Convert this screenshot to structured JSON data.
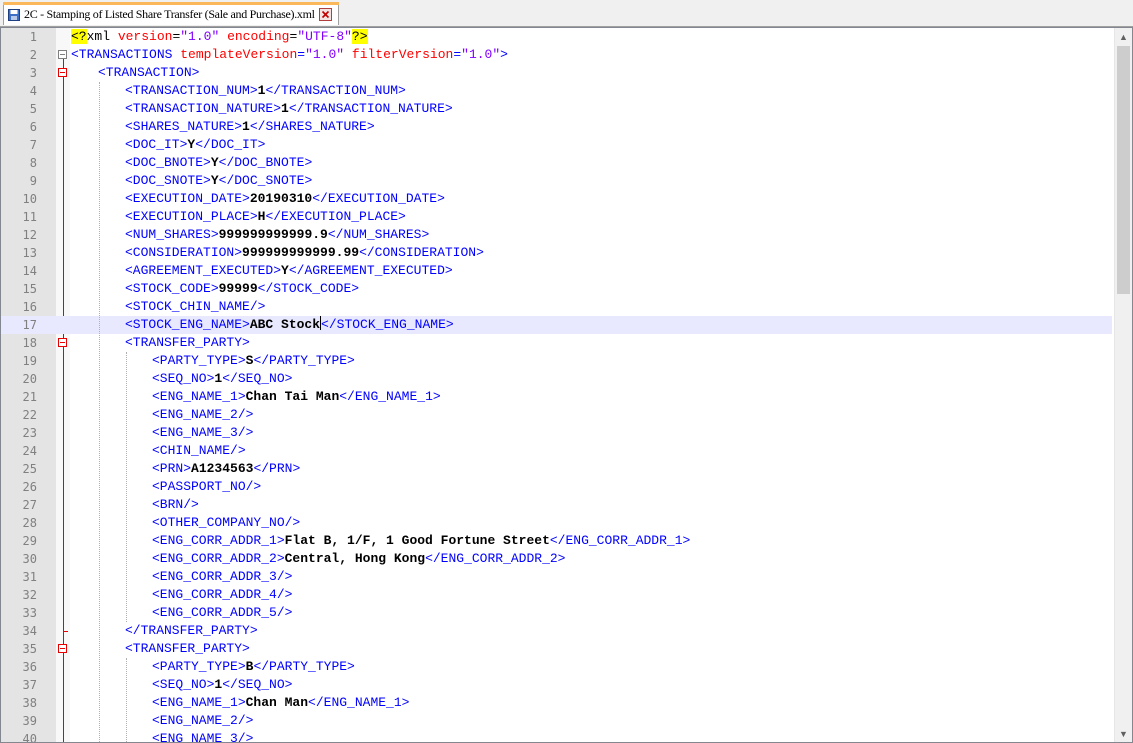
{
  "tab": {
    "title": "2C - Stamping of Listed Share Transfer (Sale and Purchase).xml",
    "save_icon": "floppy-disk-icon",
    "close_icon": "close-icon"
  },
  "colors": {
    "tag": "#0000ff",
    "attribute": "#ff0000",
    "attribute_value": "#8000ff",
    "text": "#000000",
    "highlight": "#ffff00",
    "current_line": "#e8e8ff",
    "fold_marker": "#e60000"
  },
  "editor": {
    "current_line": 17,
    "lines": [
      {
        "n": "1"
      },
      {
        "n": "2"
      },
      {
        "n": "3"
      },
      {
        "n": "4"
      },
      {
        "n": "5"
      },
      {
        "n": "6"
      },
      {
        "n": "7"
      },
      {
        "n": "8"
      },
      {
        "n": "9"
      },
      {
        "n": "10"
      },
      {
        "n": "11"
      },
      {
        "n": "12"
      },
      {
        "n": "13"
      },
      {
        "n": "14"
      },
      {
        "n": "15"
      },
      {
        "n": "16"
      },
      {
        "n": "17"
      },
      {
        "n": "18"
      },
      {
        "n": "19"
      },
      {
        "n": "20"
      },
      {
        "n": "21"
      },
      {
        "n": "22"
      },
      {
        "n": "23"
      },
      {
        "n": "24"
      },
      {
        "n": "25"
      },
      {
        "n": "26"
      },
      {
        "n": "27"
      },
      {
        "n": "28"
      },
      {
        "n": "29"
      },
      {
        "n": "30"
      },
      {
        "n": "31"
      },
      {
        "n": "32"
      },
      {
        "n": "33"
      },
      {
        "n": "34"
      },
      {
        "n": "35"
      },
      {
        "n": "36"
      },
      {
        "n": "37"
      },
      {
        "n": "38"
      },
      {
        "n": "39"
      },
      {
        "n": "40"
      }
    ]
  },
  "xml": {
    "l1": {
      "pi_open": "<?",
      "name": "xml",
      "a1": "version",
      "v1": "\"1.0\"",
      "a2": "encoding",
      "v2": "\"UTF-8\"",
      "pi_close": "?>"
    },
    "l2": {
      "open": "<TRANSACTIONS",
      "a1": "templateVersion",
      "v1": "\"1.0\"",
      "a2": "filterVersion",
      "v2": "\"1.0\"",
      "close": ">"
    },
    "l3": {
      "tag": "<TRANSACTION>"
    },
    "l4": {
      "open": "<TRANSACTION_NUM>",
      "val": "1",
      "close": "</TRANSACTION_NUM>"
    },
    "l5": {
      "open": "<TRANSACTION_NATURE>",
      "val": "1",
      "close": "</TRANSACTION_NATURE>"
    },
    "l6": {
      "open": "<SHARES_NATURE>",
      "val": "1",
      "close": "</SHARES_NATURE>"
    },
    "l7": {
      "open": "<DOC_IT>",
      "val": "Y",
      "close": "</DOC_IT>"
    },
    "l8": {
      "open": "<DOC_BNOTE>",
      "val": "Y",
      "close": "</DOC_BNOTE>"
    },
    "l9": {
      "open": "<DOC_SNOTE>",
      "val": "Y",
      "close": "</DOC_SNOTE>"
    },
    "l10": {
      "open": "<EXECUTION_DATE>",
      "val": "20190310",
      "close": "</EXECUTION_DATE>"
    },
    "l11": {
      "open": "<EXECUTION_PLACE>",
      "val": "H",
      "close": "</EXECUTION_PLACE>"
    },
    "l12": {
      "open": "<NUM_SHARES>",
      "val": "999999999999.9",
      "close": "</NUM_SHARES>"
    },
    "l13": {
      "open": "<CONSIDERATION>",
      "val": "999999999999.99",
      "close": "</CONSIDERATION>"
    },
    "l14": {
      "open": "<AGREEMENT_EXECUTED>",
      "val": "Y",
      "close": "</AGREEMENT_EXECUTED>"
    },
    "l15": {
      "open": "<STOCK_CODE>",
      "val": "99999",
      "close": "</STOCK_CODE>"
    },
    "l16": {
      "tag": "<STOCK_CHIN_NAME/>"
    },
    "l17": {
      "open": "<STOCK_ENG_NAME>",
      "val": "ABC Stock",
      "close": "</STOCK_ENG_NAME>"
    },
    "l18": {
      "tag": "<TRANSFER_PARTY>"
    },
    "l19": {
      "open": "<PARTY_TYPE>",
      "val": "S",
      "close": "</PARTY_TYPE>"
    },
    "l20": {
      "open": "<SEQ_NO>",
      "val": "1",
      "close": "</SEQ_NO>"
    },
    "l21": {
      "open": "<ENG_NAME_1>",
      "val": "Chan Tai Man",
      "close": "</ENG_NAME_1>"
    },
    "l22": {
      "tag": "<ENG_NAME_2/>"
    },
    "l23": {
      "tag": "<ENG_NAME_3/>"
    },
    "l24": {
      "tag": "<CHIN_NAME/>"
    },
    "l25": {
      "open": "<PRN>",
      "val": "A1234563",
      "close": "</PRN>"
    },
    "l26": {
      "tag": "<PASSPORT_NO/>"
    },
    "l27": {
      "tag": "<BRN/>"
    },
    "l28": {
      "tag": "<OTHER_COMPANY_NO/>"
    },
    "l29": {
      "open": "<ENG_CORR_ADDR_1>",
      "val": "Flat B, 1/F, 1 Good Fortune Street",
      "close": "</ENG_CORR_ADDR_1>"
    },
    "l30": {
      "open": "<ENG_CORR_ADDR_2>",
      "val": "Central, Hong Kong",
      "close": "</ENG_CORR_ADDR_2>"
    },
    "l31": {
      "tag": "<ENG_CORR_ADDR_3/>"
    },
    "l32": {
      "tag": "<ENG_CORR_ADDR_4/>"
    },
    "l33": {
      "tag": "<ENG_CORR_ADDR_5/>"
    },
    "l34": {
      "tag": "</TRANSFER_PARTY>"
    },
    "l35": {
      "tag": "<TRANSFER_PARTY>"
    },
    "l36": {
      "open": "<PARTY_TYPE>",
      "val": "B",
      "close": "</PARTY_TYPE>"
    },
    "l37": {
      "open": "<SEQ_NO>",
      "val": "1",
      "close": "</SEQ_NO>"
    },
    "l38": {
      "open": "<ENG_NAME_1>",
      "val": "Chan Man",
      "close": "</ENG_NAME_1>"
    },
    "l39": {
      "tag": "<ENG_NAME_2/>"
    },
    "l40": {
      "tag": "<ENG_NAME_3/>"
    }
  },
  "scrollbar": {
    "up_icon": "scroll-up-arrow-icon",
    "down_icon": "scroll-down-arrow-icon",
    "up_glyph": "▲",
    "down_glyph": "▼"
  }
}
